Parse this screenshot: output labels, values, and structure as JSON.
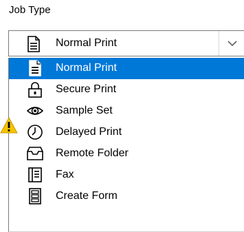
{
  "field_label": "Job Type",
  "selected_value": "Normal Print",
  "options": [
    {
      "label": "Normal Print",
      "icon": "document-icon",
      "selected": true
    },
    {
      "label": "Secure Print",
      "icon": "lock-icon",
      "selected": false
    },
    {
      "label": "Sample Set",
      "icon": "eye-icon",
      "selected": false
    },
    {
      "label": "Delayed Print",
      "icon": "clock-icon",
      "selected": false
    },
    {
      "label": "Remote Folder",
      "icon": "folder-tray-icon",
      "selected": false
    },
    {
      "label": "Fax",
      "icon": "fax-icon",
      "selected": false
    },
    {
      "label": "Create Form",
      "icon": "form-icon",
      "selected": false
    }
  ],
  "colors": {
    "selection": "#0078d7",
    "warning": "#f5c400"
  }
}
